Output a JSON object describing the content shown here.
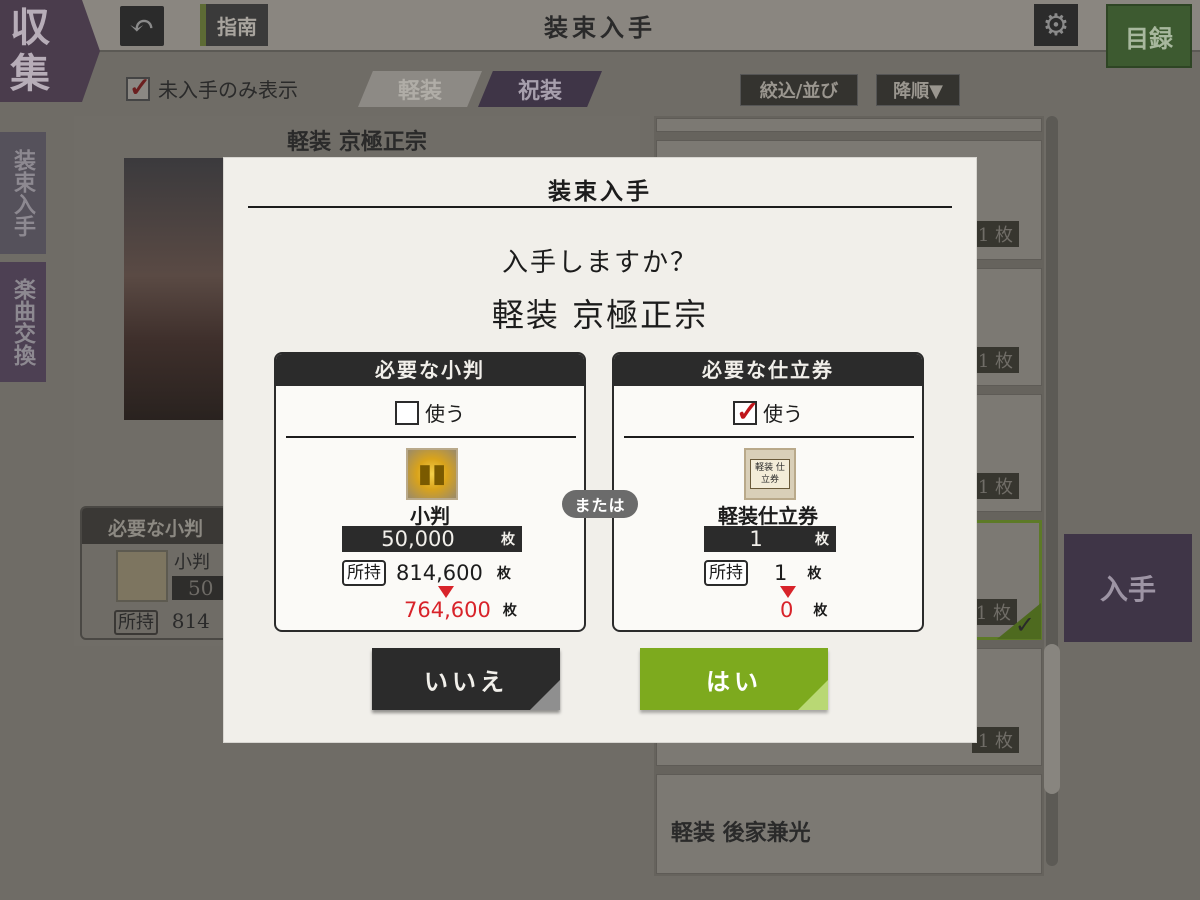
{
  "header": {
    "collection_label_1": "収",
    "collection_label_2": "集",
    "back_icon": "undo-arrow-icon",
    "guide_label": "指南",
    "title": "装束入手",
    "settings_icon": "gear-icon",
    "catalog_label": "目録"
  },
  "filters": {
    "unowned_only_label": "未入手のみ表示",
    "unowned_only_checked": true,
    "tabs": [
      "軽装",
      "祝装"
    ],
    "active_tab": "祝装",
    "filter_sort_label": "絞込/並び",
    "order_label": "降順▼"
  },
  "side_tabs": {
    "costume_obtain": "装束入手",
    "music_exchange": "楽曲交換"
  },
  "preview": {
    "title": "軽装 京極正宗",
    "card_header": "必要な小判",
    "card_item": "小判",
    "card_qty": "50",
    "card_own_tag": "所持",
    "card_own_value": "814"
  },
  "list": {
    "row_count_label": "1 枚",
    "last_row_title": "軽装 後家兼光",
    "obtain_label": "入手"
  },
  "modal": {
    "title": "装束入手",
    "question": "入手しますか？",
    "item_name": "軽装 京極正宗",
    "or_label": "または",
    "koban": {
      "header": "必要な小判",
      "use_label": "使う",
      "use_checked": false,
      "icon": "koban-gold-coins-icon",
      "item_label": "小判",
      "required": "50,000",
      "unit": "枚",
      "own_tag": "所持",
      "owned": "814,600",
      "after": "764,600"
    },
    "ticket": {
      "header": "必要な仕立券",
      "use_label": "使う",
      "use_checked": true,
      "icon": "tailoring-ticket-icon",
      "icon_text": "軽装 仕立券",
      "item_label": "軽装仕立券",
      "required": "1",
      "unit": "枚",
      "own_tag": "所持",
      "owned": "1",
      "after": "0"
    },
    "no_label": "いいえ",
    "yes_label": "はい"
  },
  "colors": {
    "accent_green": "#7daa1e",
    "alert_red": "#d8232a",
    "dark": "#2b2b2b",
    "modal_bg": "#f1efea"
  }
}
